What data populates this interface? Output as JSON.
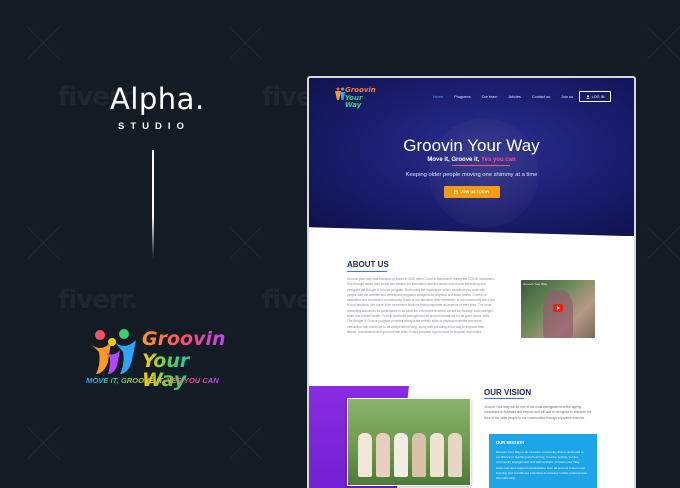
{
  "colors": {
    "background": "#131b24",
    "hero_bg": "#1c1f73",
    "accent_orange": "#f39c12",
    "accent_pink": "#ff4d8d",
    "accent_purple": "#8a2be2",
    "mission_blue": "#1ea5e8"
  },
  "watermark": "fiverr.",
  "brand": {
    "title": "Alpha.",
    "subtitle": "STUDIO"
  },
  "client_logo": {
    "line1": "Groovin",
    "line2": "Your Way",
    "tagline": "MOVE IT, GROOVE IT, YES YOU CAN"
  },
  "site": {
    "logo": {
      "line1": "Groovin",
      "line2": "Your Way"
    },
    "nav": [
      {
        "label": "Home",
        "active": true
      },
      {
        "label": "Programs",
        "active": false
      },
      {
        "label": "Our team",
        "active": false
      },
      {
        "label": "Articles",
        "active": false
      },
      {
        "label": "Contact us",
        "active": false
      },
      {
        "label": "Join us",
        "active": false
      }
    ],
    "login_label": "LOG IN",
    "hero": {
      "title": "Groovin Your Way",
      "subtitle_prefix": "Move it, Groove it,",
      "subtitle_highlight": "Yes you can",
      "description": "Keeping older people moving one shimmy at a time",
      "button": "JOIN US TODAY"
    },
    "about": {
      "heading": "ABOUT US",
      "body": "Groovin your way was founded by Annie in 2020 when Covid in Melbourne during the COVID lockdowns. She thought about how social she misses the interaction and the senior who needs interesting and designed the Boogie & Groove program. Both using the experience which contributed to work with people with the arthritis and developed programs designed for physical and brain health. Groovin is dedicated and involved in a community. Each of our fabulous older members, at our community are a fun fit and fabulous. We come from movement sections that incorporate all aspects of their lives. The most rewarding outcomes for participants is an ideal fun environment where we will be moving, build strength, brain and mental health. To help and build strength and all around formations for all good senior skills. The Boogie & Groove program provides incorporate weekly skills of physical exercise and more interaction with someone to be independent living, along with providing a fun way to improve their fitness, coordination and good mental skills. It also provides a good dose of laughter and smiles.",
      "video_title": "Groovin Your Way"
    },
    "vision": {
      "heading": "OUR VISION",
      "body": "Groovin Your Way will be one of the most distinguished active ageing companies in Australia and beyond and will add to recognise to enhance the lives of the older people in our communities through enjoyable exercise."
    },
    "mission": {
      "heading": "OUR MISSION",
      "body": "Groovin Your Way is an inclusive community that is dedicated to excellence in teaching and learning, creative activity, service, community engagement and partnerships. Groovin your Way welcomes and supports participation from all around, fosters new learning and contributes extensive knowledge locally, national and internationally."
    }
  }
}
